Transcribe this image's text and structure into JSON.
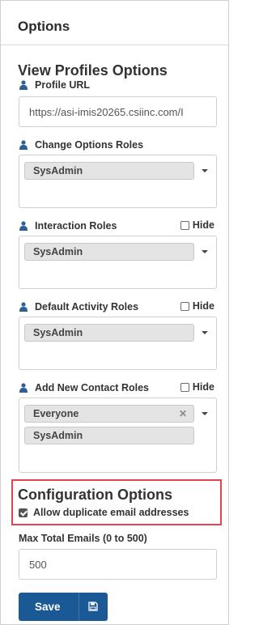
{
  "panel": {
    "title": "Options"
  },
  "view_profiles": {
    "title": "View Profiles Options",
    "profile_url": {
      "label": "Profile URL",
      "value": "https://asi-imis20265.csiinc.com/I"
    },
    "change_options_roles": {
      "label": "Change Options Roles",
      "tags": [
        "SysAdmin"
      ]
    },
    "interaction_roles": {
      "label": "Interaction Roles",
      "hide_label": "Hide",
      "tags": [
        "SysAdmin"
      ]
    },
    "default_activity_roles": {
      "label": "Default Activity Roles",
      "hide_label": "Hide",
      "tags": [
        "SysAdmin"
      ]
    },
    "add_new_contact_roles": {
      "label": "Add New Contact Roles",
      "hide_label": "Hide",
      "tags": [
        "Everyone",
        "SysAdmin"
      ]
    }
  },
  "configuration": {
    "title": "Configuration Options",
    "allow_duplicate_label": "Allow duplicate email addresses",
    "allow_duplicate_checked": true,
    "max_emails_label": "Max Total Emails (0 to 500)",
    "max_emails_value": "500"
  },
  "actions": {
    "save_label": "Save"
  },
  "icons": {
    "user": "user-icon",
    "caret": "caret-down-icon",
    "save": "floppy-disk-icon",
    "remove": "close-icon"
  },
  "colors": {
    "primary": "#1a5896",
    "highlight": "#e0454f",
    "user_icon": "#2d5f9a"
  }
}
